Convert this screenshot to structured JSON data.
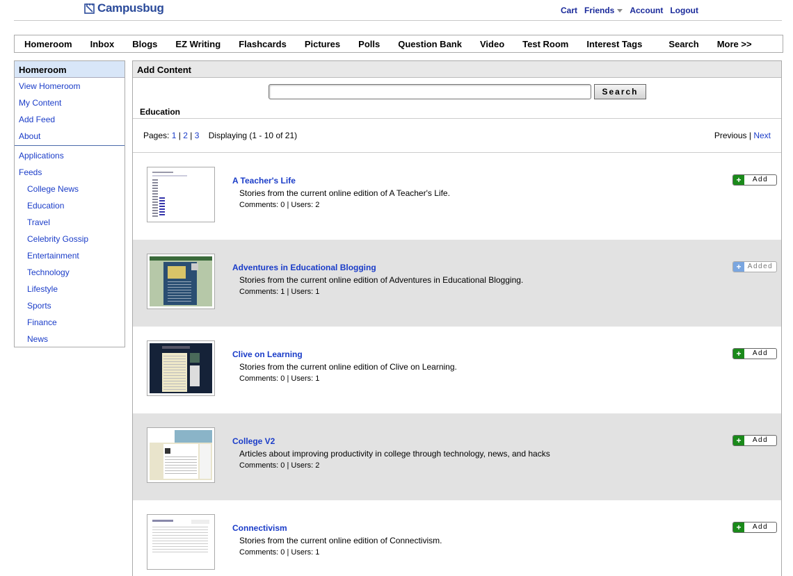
{
  "app": {
    "logo_text": "Campusbug"
  },
  "toplinks": {
    "cart": "Cart",
    "friends": "Friends",
    "account": "Account",
    "logout": "Logout"
  },
  "nav": [
    "Homeroom",
    "Inbox",
    "Blogs",
    "EZ Writing",
    "Flashcards",
    "Pictures",
    "Polls",
    "Question Bank",
    "Video",
    "Test Room",
    "Interest Tags",
    "Search",
    "More >>"
  ],
  "sidebar": {
    "title": "Homeroom",
    "items": [
      "View Homeroom",
      "My Content",
      "Add Feed",
      "About"
    ],
    "items2": [
      "Applications",
      "Feeds"
    ],
    "feeds": [
      "College News",
      "Education",
      "Travel",
      "Celebrity Gossip",
      "Entertainment",
      "Technology",
      "Lifestyle",
      "Sports",
      "Finance",
      "News"
    ]
  },
  "main": {
    "title": "Add Content",
    "search": {
      "value": "",
      "button": "Search"
    },
    "category": "Education",
    "pager": {
      "label": "Pages:",
      "pages": [
        "1",
        "2",
        "3"
      ],
      "sep": "|",
      "displaying": "Displaying (1 - 10 of 21)",
      "previous": "Previous",
      "next": "Next"
    },
    "feeds": [
      {
        "title": "A Teacher's Life",
        "desc": "Stories from the current online edition of A Teacher's Life.",
        "meta": "Comments: 0 | Users: 2",
        "button": "Add",
        "added": false
      },
      {
        "title": "Adventures in Educational Blogging",
        "desc": "Stories from the current online edition of Adventures in Educational Blogging.",
        "meta": "Comments: 1 | Users: 1",
        "button": "Added",
        "added": true
      },
      {
        "title": "Clive on Learning",
        "desc": "Stories from the current online edition of Clive on Learning.",
        "meta": "Comments: 0 | Users: 1",
        "button": "Add",
        "added": false
      },
      {
        "title": "College V2",
        "desc": "Articles about improving productivity in college through technology, news, and hacks",
        "meta": "Comments: 0 | Users: 2",
        "button": "Add",
        "added": false
      },
      {
        "title": "Connectivism",
        "desc": "Stories from the current online edition of Connectivism.",
        "meta": "Comments: 0 | Users: 1",
        "button": "Add",
        "added": false
      }
    ]
  },
  "colors": {
    "link": "#1a3cc8",
    "sidebar_head": "#d8e6f8",
    "alt_row": "#e2e2e2",
    "add_green": "#1a8a1a",
    "added_blue": "#7aa6e0"
  },
  "icons": {
    "logo": "notebook-icon",
    "friends_menu": "caret-down-icon",
    "add": "plus-icon"
  }
}
